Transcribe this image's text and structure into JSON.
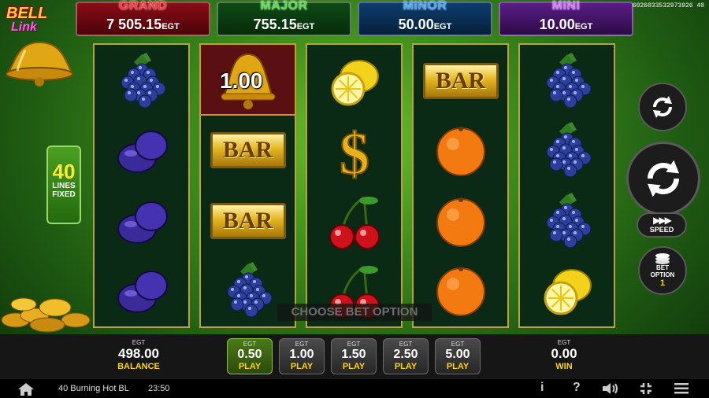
{
  "logo": {
    "line1": "BELL",
    "line2": "Link"
  },
  "game_id": "6026033532973926 40",
  "jackpots": [
    {
      "title": "GRAND",
      "value": "7 505.15",
      "currency": "EGT"
    },
    {
      "title": "MAJOR",
      "value": "755.15",
      "currency": "EGT"
    },
    {
      "title": "MINOR",
      "value": "50.00",
      "currency": "EGT"
    },
    {
      "title": "MINI",
      "value": "10.00",
      "currency": "EGT"
    }
  ],
  "lines": {
    "count": "40",
    "line1": "LINES",
    "line2": "FIXED"
  },
  "reels": [
    [
      "grape",
      "plum",
      "plum",
      "plum"
    ],
    [
      "bell",
      "bar",
      "bar",
      "grape"
    ],
    [
      "lemon",
      "dollar",
      "cherry",
      "cherry"
    ],
    [
      "bar",
      "orange",
      "orange",
      "orange"
    ],
    [
      "grape",
      "grape",
      "grape",
      "lemon"
    ]
  ],
  "bell_value": "1.00",
  "bar_label": "BAR",
  "choose_bet": "CHOOSE BET OPTION",
  "autoplay_icon": "autoplay-icon",
  "spin_icon": "spin-icon",
  "speed": {
    "arrows": "▶▶▶",
    "label": "SPEED"
  },
  "bet_option": {
    "line1": "BET",
    "line2": "OPTION",
    "value": "1"
  },
  "balance": {
    "currency": "EGT",
    "value": "498.00",
    "label": "BALANCE"
  },
  "bets": [
    {
      "currency": "EGT",
      "value": "0.50",
      "label": "PLAY",
      "active": true
    },
    {
      "currency": "EGT",
      "value": "1.00",
      "label": "PLAY",
      "active": false
    },
    {
      "currency": "EGT",
      "value": "1.50",
      "label": "PLAY",
      "active": false
    },
    {
      "currency": "EGT",
      "value": "2.50",
      "label": "PLAY",
      "active": false
    },
    {
      "currency": "EGT",
      "value": "5.00",
      "label": "PLAY",
      "active": false
    }
  ],
  "win": {
    "currency": "EGT",
    "value": "0.00",
    "label": "WIN"
  },
  "status": {
    "game_name": "40 Burning Hot BL",
    "time": "23:50"
  },
  "status_icons": {
    "info": "i",
    "help": "?"
  }
}
